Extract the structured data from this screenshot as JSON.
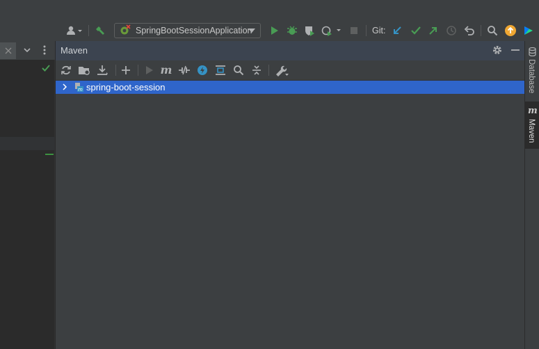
{
  "toolbar": {
    "run_config": "SpringBootSessionApplication",
    "git_label": "Git:"
  },
  "maven": {
    "title": "Maven",
    "tree": [
      {
        "label": "spring-boot-session"
      }
    ]
  },
  "right_stripe": {
    "database_label": "Database",
    "maven_label": "Maven"
  },
  "colors": {
    "accent_blue": "#2f65ca",
    "run_green": "#499c54",
    "git_blue": "#3592c4",
    "update_orange": "#f0a732"
  },
  "icons": {
    "top_toolbar": [
      "user-icon",
      "build-hammer-icon",
      "spring-boot-icon",
      "run-icon",
      "debug-icon",
      "coverage-icon",
      "profile-icon",
      "stop-icon",
      "git-update-icon",
      "git-commit-icon",
      "git-push-icon",
      "history-icon",
      "rollback-icon",
      "search-icon",
      "update-icon",
      "toolbox-icon"
    ],
    "maven_toolbar": [
      "reload-icon",
      "generate-sources-icon",
      "download-icon",
      "add-icon",
      "run-icon",
      "execute-goal-icon",
      "toggle-offline-icon",
      "skip-tests-icon",
      "show-dependencies-icon",
      "find-icon",
      "collapse-all-icon",
      "settings-wrench-icon"
    ]
  }
}
